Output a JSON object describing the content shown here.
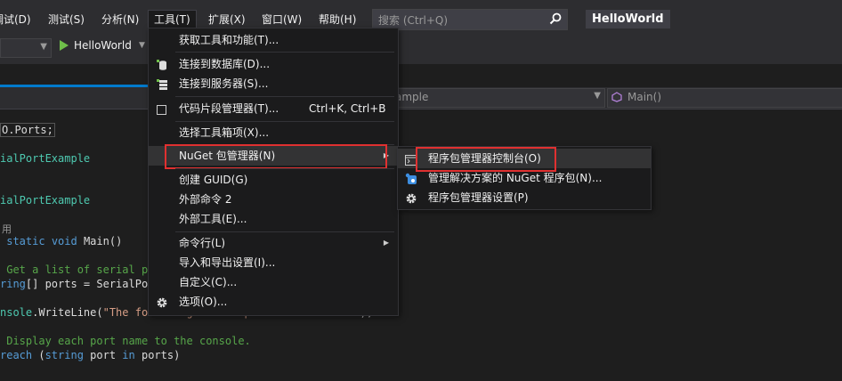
{
  "menubar": {
    "items": [
      "测试(S)",
      "分析(N)",
      "工具(T)",
      "扩展(X)",
      "窗口(W)",
      "帮助(H)"
    ],
    "first_partial": "调试(D)",
    "search_placeholder": "搜索 (Ctrl+Q)",
    "app_title": "HelloWorld"
  },
  "toolbar": {
    "run_label": "HelloWorld"
  },
  "navbar": {
    "type_text": "ample",
    "member_text": "Main()"
  },
  "code": {
    "line1": "O.Ports;",
    "line2": "ialPortExample",
    "line3": "ialPortExample",
    "line4_refs": "用",
    "line5_kw1": "static",
    "line5_kw2": "void",
    "line5_rest": " Main()",
    "line6": "Get a list of serial po",
    "line7_a": "ring",
    "line7_b": "[] ports = SerialPor",
    "line8_a": "nsole",
    "line8_b": ".WriteLine(",
    "line8_c": "\"The following serial ports were found:\"",
    "line8_d": ");",
    "line9": "Display each port name to the console.",
    "line10_a": "reach",
    "line10_b": " (",
    "line10_c": "string",
    "line10_d": " port ",
    "line10_e": "in",
    "line10_f": " ports)"
  },
  "tools_menu": {
    "items": [
      {
        "label": "获取工具和功能(T)...",
        "icon": "none"
      },
      {
        "label": "连接到数据库(D)...",
        "icon": "database-icon"
      },
      {
        "label": "连接到服务器(S)...",
        "icon": "server-icon"
      },
      {
        "label": "代码片段管理器(T)...",
        "shortcut": "Ctrl+K, Ctrl+B",
        "icon": "checkbox-icon"
      },
      {
        "label": "选择工具箱项(X)...",
        "icon": "none"
      },
      {
        "label": "NuGet 包管理器(N)",
        "icon": "none",
        "submenu": true
      },
      {
        "label": "创建 GUID(G)",
        "icon": "none"
      },
      {
        "label": "外部命令 2",
        "icon": "none"
      },
      {
        "label": "外部工具(E)...",
        "icon": "none"
      },
      {
        "label": "命令行(L)",
        "icon": "none",
        "submenu": true
      },
      {
        "label": "导入和导出设置(I)...",
        "icon": "none"
      },
      {
        "label": "自定义(C)...",
        "icon": "none"
      },
      {
        "label": "选项(O)...",
        "icon": "gear-icon"
      }
    ]
  },
  "nuget_submenu": {
    "items": [
      {
        "label": "程序包管理器控制台(O)",
        "icon": "console-icon"
      },
      {
        "label": "管理解决方案的 NuGet 程序包(N)...",
        "icon": "nuget-icon"
      },
      {
        "label": "程序包管理器设置(P)",
        "icon": "gear-icon"
      }
    ]
  },
  "colors": {
    "highlight_box": "#e03030",
    "accent": "#007acc"
  }
}
